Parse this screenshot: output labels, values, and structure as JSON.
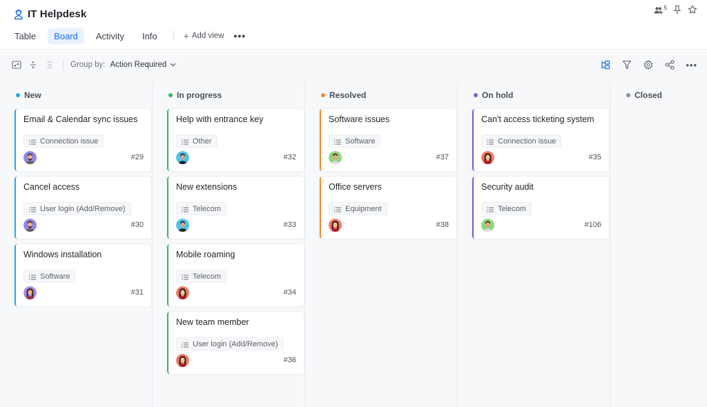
{
  "app": {
    "title": "IT Helpdesk",
    "title_icon": "helpdesk-agent-icon"
  },
  "tabs": [
    {
      "label": "Table",
      "active": false
    },
    {
      "label": "Board",
      "active": true
    },
    {
      "label": "Activity",
      "active": false
    },
    {
      "label": "Info",
      "active": false
    }
  ],
  "add_view_label": "Add view",
  "more_label": "•••",
  "top_right": {
    "members_count": "5",
    "icons": [
      "members-icon",
      "pin-icon",
      "star-icon"
    ]
  },
  "toolbar": {
    "group_by_label": "Group by:",
    "group_by_value": "Action Required",
    "left_icons": [
      "expand-icon",
      "collapse-rows-icon",
      "collapse-all-icon"
    ],
    "right_icons": [
      "hierarchy-icon",
      "filter-icon",
      "settings-icon",
      "share-icon",
      "more-icon"
    ],
    "more_label": "•••"
  },
  "colors": {
    "accent": "#1a73e8",
    "new": "#2aa6f0",
    "in_progress": "#3cb55a",
    "resolved": "#f28a30",
    "on_hold": "#7a5cd6",
    "closed": "#8a8f97"
  },
  "columns": [
    {
      "title": "New",
      "color": "#2aa6f0",
      "cards": [
        {
          "title": "Email & Calendar sync issues",
          "tag": "Connection issue",
          "ticket": "#29",
          "avatar": "avatar-man-beard"
        },
        {
          "title": "Cancel access",
          "tag": "User login (Add/Remove)",
          "ticket": "#30",
          "avatar": "avatar-man-beard"
        },
        {
          "title": "Windows installation",
          "tag": "Software",
          "ticket": "#31",
          "avatar": "avatar-woman-purple"
        }
      ]
    },
    {
      "title": "In progress",
      "color": "#3cb55a",
      "cards": [
        {
          "title": "Help with entrance key",
          "tag": "Other",
          "ticket": "#32",
          "avatar": "avatar-man-blue"
        },
        {
          "title": "New extensions",
          "tag": "Telecom",
          "ticket": "#33",
          "avatar": "avatar-man-blue"
        },
        {
          "title": "Mobile roaming",
          "tag": "Telecom",
          "ticket": "#34",
          "avatar": "avatar-woman-red"
        },
        {
          "title": "New team member",
          "tag": "User login (Add/Remove)",
          "ticket": "#36",
          "avatar": "avatar-woman-red"
        }
      ]
    },
    {
      "title": "Resolved",
      "color": "#f28a30",
      "cards": [
        {
          "title": "Software issues",
          "tag": "Software",
          "ticket": "#37",
          "avatar": "avatar-man-green"
        },
        {
          "title": "Office servers",
          "tag": "Equipment",
          "ticket": "#38",
          "avatar": "avatar-woman-red"
        }
      ]
    },
    {
      "title": "On hold",
      "color": "#7a5cd6",
      "cards": [
        {
          "title": "Can't access ticketing system",
          "tag": "Connection issue",
          "ticket": "#35",
          "avatar": "avatar-woman-red"
        },
        {
          "title": "Security audit",
          "tag": "Telecom",
          "ticket": "#106",
          "avatar": "avatar-man-green"
        }
      ]
    },
    {
      "title": "Closed",
      "color": "#8a8f97",
      "cards": []
    }
  ]
}
